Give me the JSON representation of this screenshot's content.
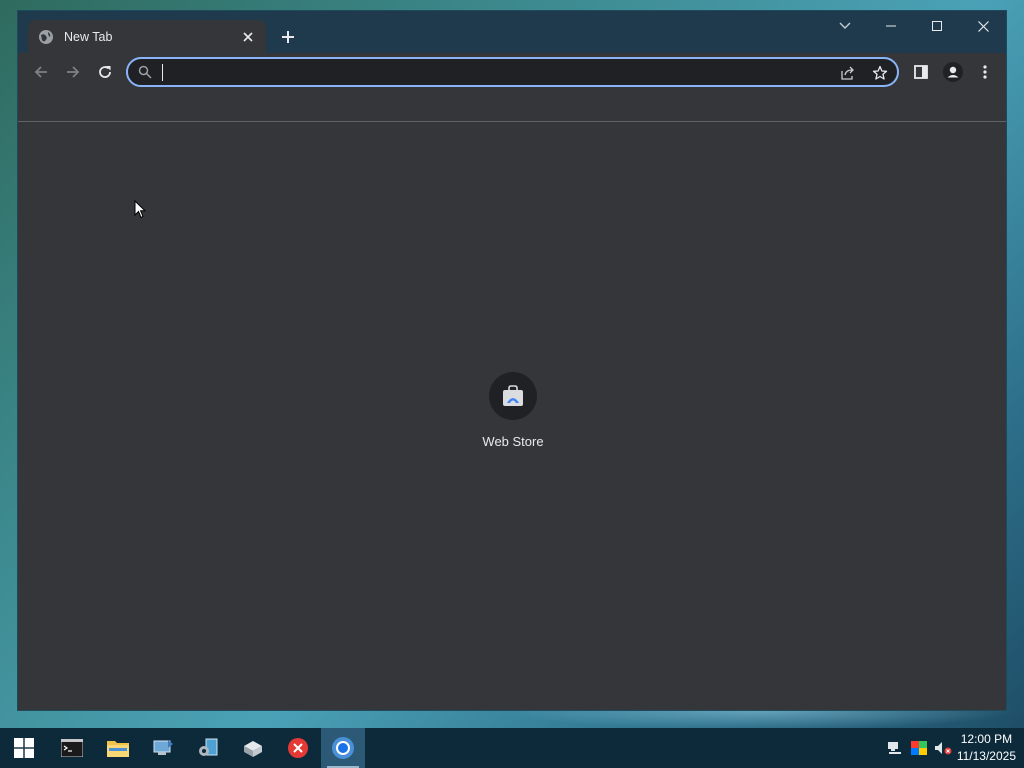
{
  "browser": {
    "tab": {
      "title": "New Tab"
    },
    "omnibox": {
      "value": "",
      "placeholder": ""
    }
  },
  "new_tab_page": {
    "shortcuts": [
      {
        "label": "Web Store"
      }
    ]
  },
  "taskbar": {
    "items": [
      {
        "name": "start",
        "icon": "windows-logo-icon"
      },
      {
        "name": "terminal",
        "icon": "terminal-icon"
      },
      {
        "name": "file-explorer",
        "icon": "folder-icon"
      },
      {
        "name": "network-app",
        "icon": "network-computer-icon"
      },
      {
        "name": "settings-app",
        "icon": "gear-computer-icon"
      },
      {
        "name": "server-app",
        "icon": "server-icon"
      },
      {
        "name": "error-app",
        "icon": "red-x-icon"
      },
      {
        "name": "chrome",
        "icon": "chrome-icon",
        "active": true
      }
    ],
    "clock": {
      "time": "12:00 PM",
      "date": "11/13/2025"
    }
  },
  "colors": {
    "titlebar": "#1f3a4d",
    "window_bg": "#35363a",
    "omnibox_border": "#8ab4f8",
    "taskbar": "#0c2a3a",
    "taskbar_active": "#2c5a76"
  }
}
